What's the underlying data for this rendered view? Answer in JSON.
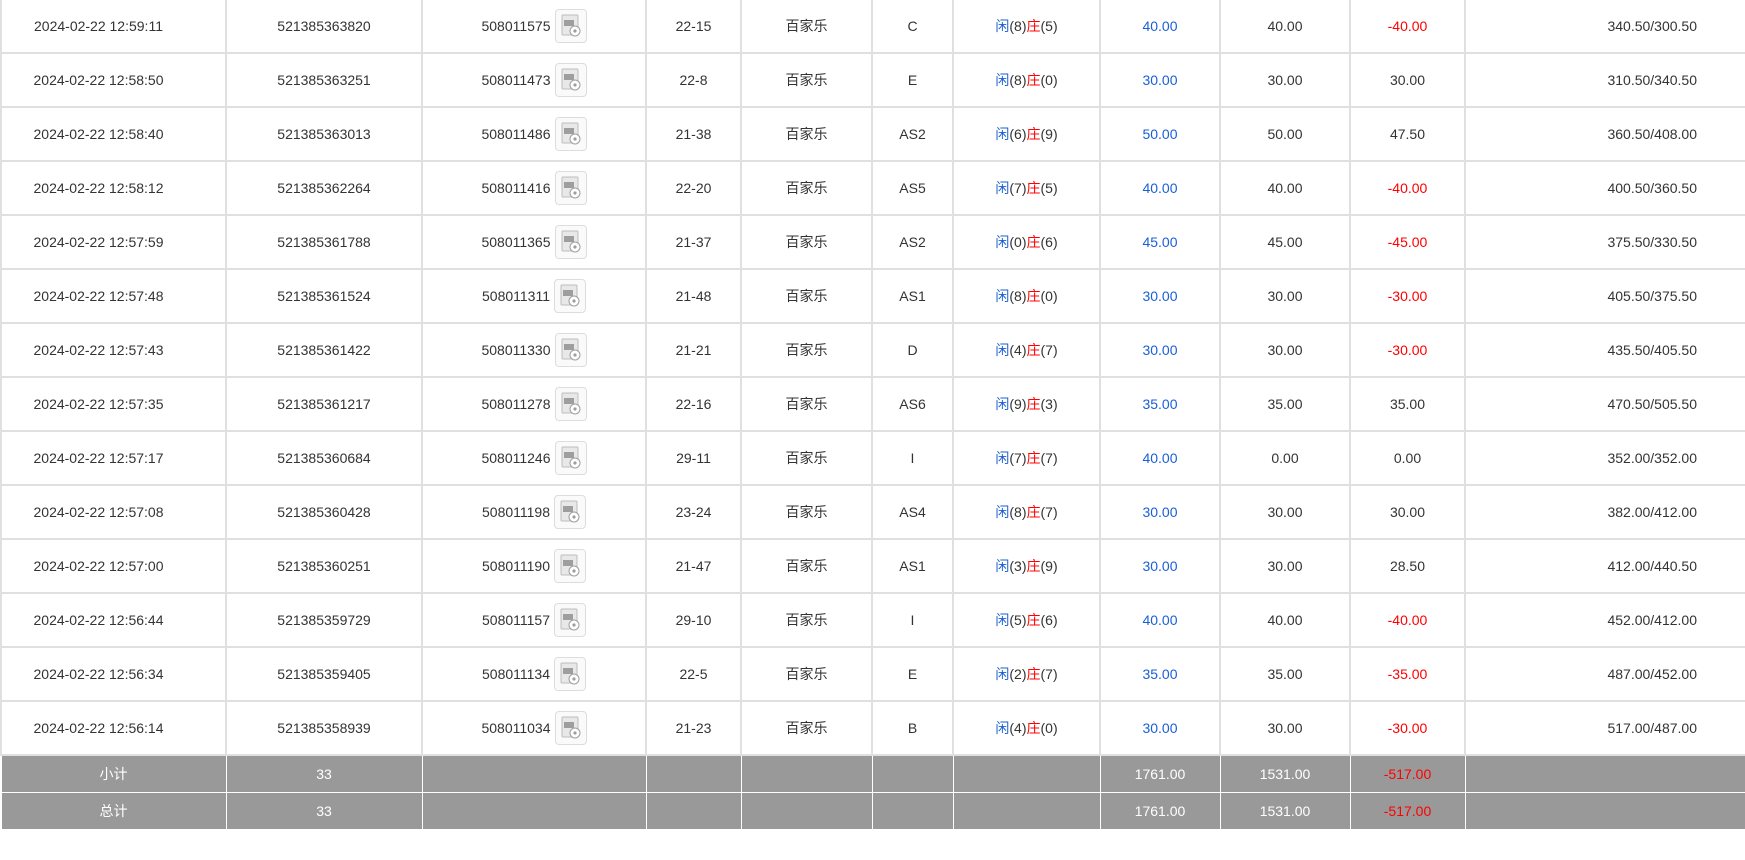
{
  "rows": [
    {
      "time": "2024-02-22 12:59:11",
      "bet_id": "521385363820",
      "round_id": "508011575",
      "shoe": "22-15",
      "game": "百家乐",
      "table": "C",
      "player_label": "闲",
      "player": "(8)",
      "banker_label": "庄",
      "banker": "(5)",
      "bet": "40.00",
      "valid": "40.00",
      "win": "-40.00",
      "win_neg": true,
      "balance": "340.50/300.50"
    },
    {
      "time": "2024-02-22 12:58:50",
      "bet_id": "521385363251",
      "round_id": "508011473",
      "shoe": "22-8",
      "game": "百家乐",
      "table": "E",
      "player_label": "闲",
      "player": "(8)",
      "banker_label": "庄",
      "banker": "(0)",
      "bet": "30.00",
      "valid": "30.00",
      "win": "30.00",
      "win_neg": false,
      "balance": "310.50/340.50"
    },
    {
      "time": "2024-02-22 12:58:40",
      "bet_id": "521385363013",
      "round_id": "508011486",
      "shoe": "21-38",
      "game": "百家乐",
      "table": "AS2",
      "player_label": "闲",
      "player": "(6)",
      "banker_label": "庄",
      "banker": "(9)",
      "bet": "50.00",
      "valid": "50.00",
      "win": "47.50",
      "win_neg": false,
      "balance": "360.50/408.00"
    },
    {
      "time": "2024-02-22 12:58:12",
      "bet_id": "521385362264",
      "round_id": "508011416",
      "shoe": "22-20",
      "game": "百家乐",
      "table": "AS5",
      "player_label": "闲",
      "player": "(7)",
      "banker_label": "庄",
      "banker": "(5)",
      "bet": "40.00",
      "valid": "40.00",
      "win": "-40.00",
      "win_neg": true,
      "balance": "400.50/360.50"
    },
    {
      "time": "2024-02-22 12:57:59",
      "bet_id": "521385361788",
      "round_id": "508011365",
      "shoe": "21-37",
      "game": "百家乐",
      "table": "AS2",
      "player_label": "闲",
      "player": "(0)",
      "banker_label": "庄",
      "banker": "(6)",
      "bet": "45.00",
      "valid": "45.00",
      "win": "-45.00",
      "win_neg": true,
      "balance": "375.50/330.50"
    },
    {
      "time": "2024-02-22 12:57:48",
      "bet_id": "521385361524",
      "round_id": "508011311",
      "shoe": "21-48",
      "game": "百家乐",
      "table": "AS1",
      "player_label": "闲",
      "player": "(8)",
      "banker_label": "庄",
      "banker": "(0)",
      "bet": "30.00",
      "valid": "30.00",
      "win": "-30.00",
      "win_neg": true,
      "balance": "405.50/375.50"
    },
    {
      "time": "2024-02-22 12:57:43",
      "bet_id": "521385361422",
      "round_id": "508011330",
      "shoe": "21-21",
      "game": "百家乐",
      "table": "D",
      "player_label": "闲",
      "player": "(4)",
      "banker_label": "庄",
      "banker": "(7)",
      "bet": "30.00",
      "valid": "30.00",
      "win": "-30.00",
      "win_neg": true,
      "balance": "435.50/405.50"
    },
    {
      "time": "2024-02-22 12:57:35",
      "bet_id": "521385361217",
      "round_id": "508011278",
      "shoe": "22-16",
      "game": "百家乐",
      "table": "AS6",
      "player_label": "闲",
      "player": "(9)",
      "banker_label": "庄",
      "banker": "(3)",
      "bet": "35.00",
      "valid": "35.00",
      "win": "35.00",
      "win_neg": false,
      "balance": "470.50/505.50"
    },
    {
      "time": "2024-02-22 12:57:17",
      "bet_id": "521385360684",
      "round_id": "508011246",
      "shoe": "29-11",
      "game": "百家乐",
      "table": "I",
      "player_label": "闲",
      "player": "(7)",
      "banker_label": "庄",
      "banker": "(7)",
      "bet": "40.00",
      "valid": "0.00",
      "win": "0.00",
      "win_neg": false,
      "balance": "352.00/352.00"
    },
    {
      "time": "2024-02-22 12:57:08",
      "bet_id": "521385360428",
      "round_id": "508011198",
      "shoe": "23-24",
      "game": "百家乐",
      "table": "AS4",
      "player_label": "闲",
      "player": "(8)",
      "banker_label": "庄",
      "banker": "(7)",
      "bet": "30.00",
      "valid": "30.00",
      "win": "30.00",
      "win_neg": false,
      "balance": "382.00/412.00"
    },
    {
      "time": "2024-02-22 12:57:00",
      "bet_id": "521385360251",
      "round_id": "508011190",
      "shoe": "21-47",
      "game": "百家乐",
      "table": "AS1",
      "player_label": "闲",
      "player": "(3)",
      "banker_label": "庄",
      "banker": "(9)",
      "bet": "30.00",
      "valid": "30.00",
      "win": "28.50",
      "win_neg": false,
      "balance": "412.00/440.50"
    },
    {
      "time": "2024-02-22 12:56:44",
      "bet_id": "521385359729",
      "round_id": "508011157",
      "shoe": "29-10",
      "game": "百家乐",
      "table": "I",
      "player_label": "闲",
      "player": "(5)",
      "banker_label": "庄",
      "banker": "(6)",
      "bet": "40.00",
      "valid": "40.00",
      "win": "-40.00",
      "win_neg": true,
      "balance": "452.00/412.00"
    },
    {
      "time": "2024-02-22 12:56:34",
      "bet_id": "521385359405",
      "round_id": "508011134",
      "shoe": "22-5",
      "game": "百家乐",
      "table": "E",
      "player_label": "闲",
      "player": "(2)",
      "banker_label": "庄",
      "banker": "(7)",
      "bet": "35.00",
      "valid": "35.00",
      "win": "-35.00",
      "win_neg": true,
      "balance": "487.00/452.00"
    },
    {
      "time": "2024-02-22 12:56:14",
      "bet_id": "521385358939",
      "round_id": "508011034",
      "shoe": "21-23",
      "game": "百家乐",
      "table": "B",
      "player_label": "闲",
      "player": "(4)",
      "banker_label": "庄",
      "banker": "(0)",
      "bet": "30.00",
      "valid": "30.00",
      "win": "-30.00",
      "win_neg": true,
      "balance": "517.00/487.00",
      "highlight": true
    }
  ],
  "subtotal": {
    "label": "小计",
    "count": "33",
    "bet": "1761.00",
    "valid": "1531.00",
    "win": "-517.00"
  },
  "total": {
    "label": "总计",
    "count": "33",
    "bet": "1761.00",
    "valid": "1531.00",
    "win": "-517.00"
  },
  "colors": {
    "highlight": "#ffff99",
    "summary_bg": "#999999",
    "negative": "#ff0000",
    "player_blue": "#1a5fd6",
    "banker_red": "#ff0000"
  },
  "icons": {
    "round_detail": "video-replay-icon"
  }
}
